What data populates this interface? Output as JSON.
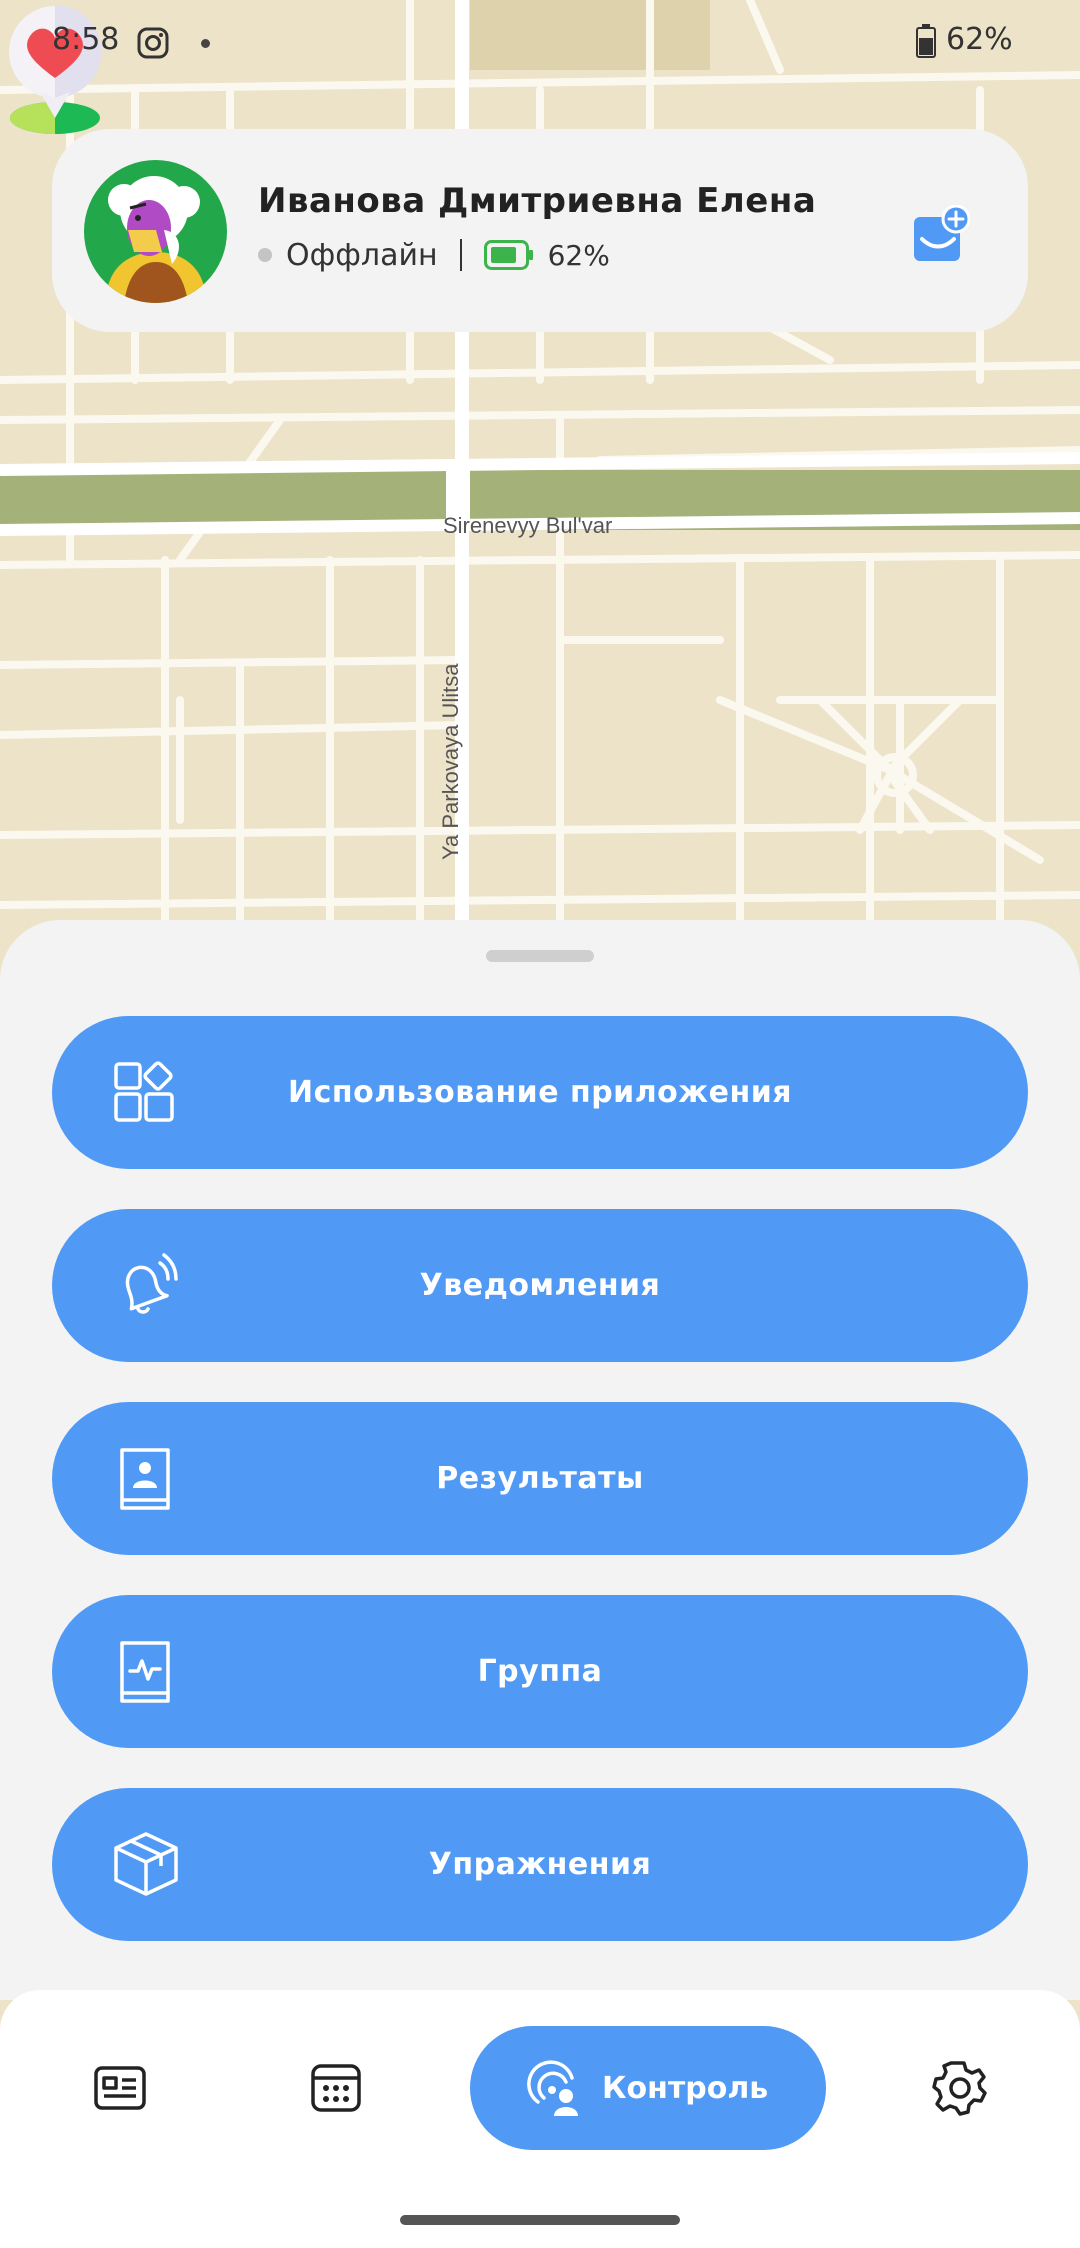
{
  "status_bar": {
    "time": "8:58",
    "battery": "62%"
  },
  "profile": {
    "name": "Иванова Дмитриевна Елена",
    "status": "Оффлайн",
    "battery": "62%"
  },
  "map": {
    "street_horizontal": "Sirenevyy Bul'var",
    "street_vertical": "Ya Parkovaya Ulitsa"
  },
  "menu": [
    {
      "label": "Использование приложения",
      "icon": "apps-icon"
    },
    {
      "label": "Уведомления",
      "icon": "bell-icon"
    },
    {
      "label": "Результаты",
      "icon": "contacts-book-icon"
    },
    {
      "label": "Группа",
      "icon": "health-book-icon"
    },
    {
      "label": "Упражнения",
      "icon": "box-icon"
    }
  ],
  "nav": {
    "items": [
      "news-icon",
      "calendar-icon",
      "control-icon",
      "settings-icon"
    ],
    "active_label": "Контроль"
  },
  "colors": {
    "accent": "#509af6",
    "map_bg": "#ece3c9",
    "park": "#a4b27a",
    "battery_green": "#3cb44b"
  }
}
